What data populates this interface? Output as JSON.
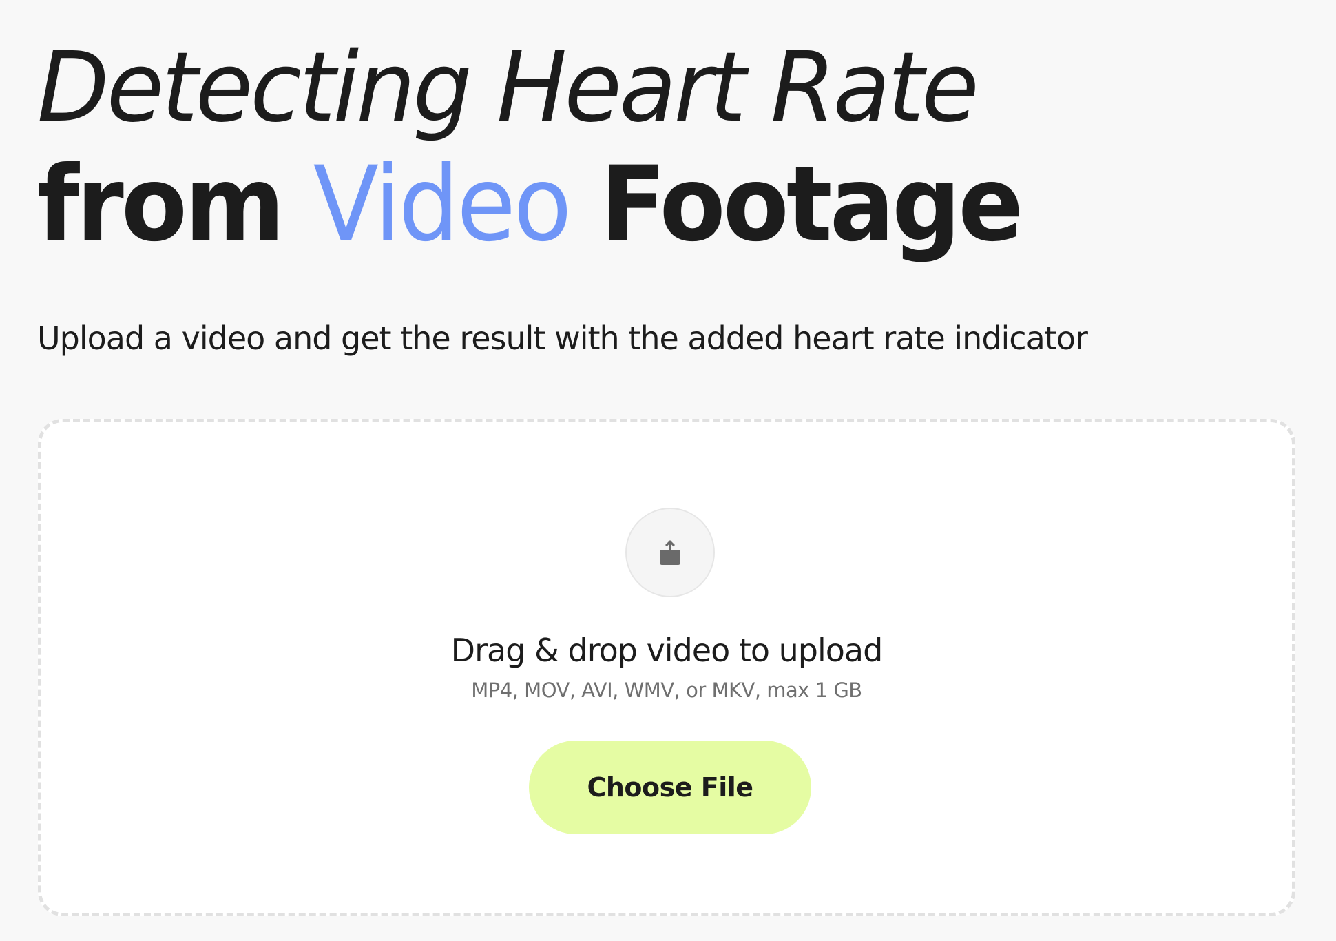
{
  "hero": {
    "title_line_1": "Detecting Heart Rate",
    "title_line_2_prefix": "from ",
    "title_line_2_accent": "Video",
    "title_line_2_suffix": " Footage",
    "subtitle": "Upload a video and get the result with the added heart rate indicator"
  },
  "dropzone": {
    "icon": "upload-icon",
    "title": "Drag & drop video to upload",
    "hint": "MP4, MOV, AVI, WMV, or MKV, max 1 GB",
    "button_label": "Choose File"
  },
  "colors": {
    "background": "#f8f8f8",
    "accent_blue": "#6f95f7",
    "button_lime": "#e5fca3",
    "dropzone_border": "#e1e1e1",
    "text_dark": "#1c1c1c",
    "text_muted": "#6f6f6f"
  }
}
